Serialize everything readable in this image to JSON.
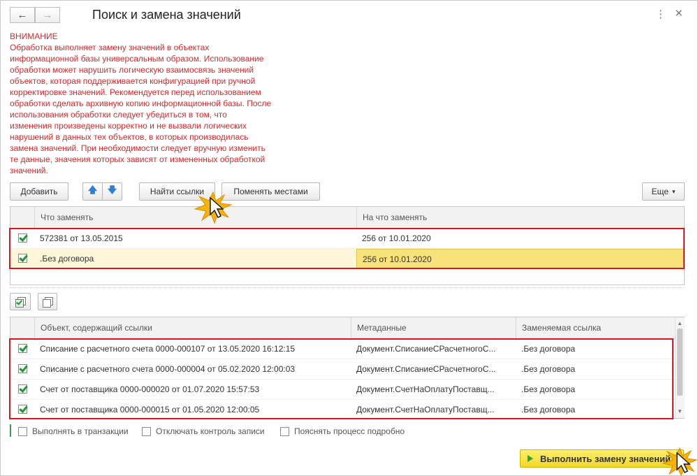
{
  "window": {
    "title": "Поиск и замена значений",
    "back_icon": "←",
    "forward_icon": "→",
    "more_icon": "⋮",
    "close_icon": "×"
  },
  "warning": {
    "heading": "ВНИМАНИЕ",
    "lines": [
      "Обработка выполняет замену значений в объектах",
      "информационной базы универсальным образом.  Использование",
      "обработки может нарушить логическую взаимосвязь значений",
      "объектов, которая поддерживается конфигурацией при ручной",
      "корректировке значений. Рекомендуется перед использованием",
      "обработки сделать архивную копию информационной базы. После",
      "использования обработки следует убедиться в том, что",
      "изменения произведены корректно и не вызвали логических",
      "нарушений в данных тех объектов, в которых производилась",
      "замена значений. При необходимости следует вручную изменить",
      "те данные, значения которых зависят от измененных обработкой",
      "значений."
    ]
  },
  "toolbar": {
    "add_label": "Добавить",
    "up_icon": "🡅",
    "down_icon": "🡇",
    "find_refs_label": "Найти ссылки",
    "swap_label": "Поменять местами",
    "more_label": "Еще",
    "more_caret": "▾"
  },
  "replace_table": {
    "headers": [
      "Что заменять",
      "На что заменять"
    ],
    "rows": [
      {
        "checked": true,
        "what": "572381 от 13.05.2015",
        "to": "256 от 10.01.2020"
      },
      {
        "checked": true,
        "what": ".Без договора",
        "to": "256 от 10.01.2020"
      }
    ]
  },
  "refs_table": {
    "headers": [
      "Объект, содержащий ссылки",
      "Метаданные",
      "Заменяемая ссылка"
    ],
    "rows": [
      {
        "checked": true,
        "object": "Списание с расчетного счета 0000-000107 от 13.05.2020 16:12:15",
        "meta": "Документ.СписаниеСРасчетногоС...",
        "ref": ".Без договора"
      },
      {
        "checked": true,
        "object": "Списание с расчетного счета 0000-000004 от 05.02.2020 12:00:03",
        "meta": "Документ.СписаниеСРасчетногоС...",
        "ref": ".Без договора"
      },
      {
        "checked": true,
        "object": "Счет от поставщика 0000-000020 от 01.07.2020 15:57:53",
        "meta": "Документ.СчетНаОплатуПоставщ...",
        "ref": ".Без договора"
      },
      {
        "checked": true,
        "object": "Счет от поставщика 0000-000015 от 01.05.2020 12:00:05",
        "meta": "Документ.СчетНаОплатуПоставщ...",
        "ref": ".Без договора"
      }
    ]
  },
  "options": {
    "transaction": "Выполнять в транзакции",
    "disable_control": "Отключать контроль записи",
    "explain": "Пояснять процесс подробно"
  },
  "execute_label": "Выполнить замену значений",
  "colors": {
    "warning": "#e0262a",
    "highlight_row": "#fdf6d8",
    "highlight_cell": "#f8e27a",
    "red_frame": "#e0121c",
    "exec_button": "#f2d82a"
  }
}
